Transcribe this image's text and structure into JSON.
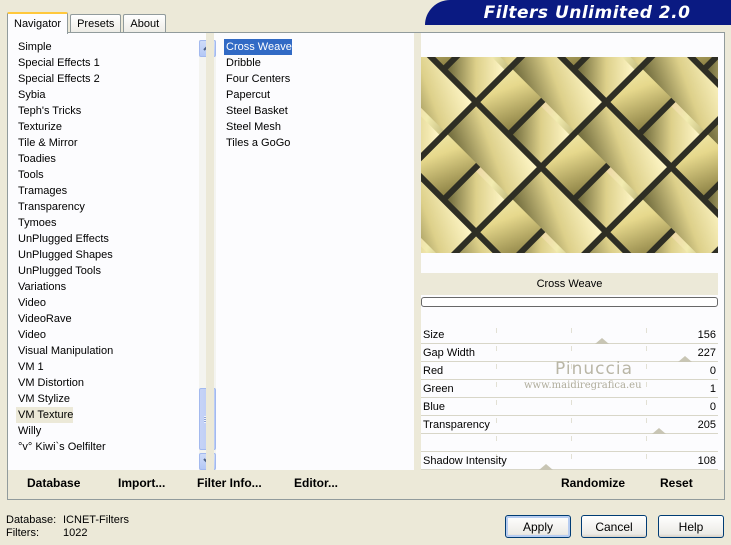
{
  "tabs": [
    {
      "label": "Navigator",
      "active": true
    },
    {
      "label": "Presets",
      "active": false
    },
    {
      "label": "About",
      "active": false
    }
  ],
  "banner": "Filters Unlimited 2.0",
  "categories": [
    "Simple",
    "Special Effects 1",
    "Special Effects 2",
    "Sybia",
    "Teph's Tricks",
    "Texturize",
    "Tile & Mirror",
    "Toadies",
    "Tools",
    "Tramages",
    "Transparency",
    "Tymoes",
    "UnPlugged Effects",
    "UnPlugged Shapes",
    "UnPlugged Tools",
    "Variations",
    "Video",
    "VideoRave",
    "Video",
    "Visual Manipulation",
    "VM 1",
    "VM Distortion",
    "VM Stylize",
    "VM Texture",
    "Willy",
    "°v° Kiwi`s Oelfilter"
  ],
  "selected_category": "VM Texture",
  "filters": [
    "Cross Weave",
    "Dribble",
    "Four Centers",
    "Papercut",
    "Steel Basket",
    "Steel Mesh",
    "Tiles a GoGo"
  ],
  "selected_filter": "Cross Weave",
  "preview_title": "Cross Weave",
  "progress": 0,
  "parameters": [
    {
      "label": "Size",
      "value": "156",
      "level": 0.61
    },
    {
      "label": "Gap Width",
      "value": "227",
      "level": 0.89
    },
    {
      "label": "Red",
      "value": "0",
      "level": 0
    },
    {
      "label": "Green",
      "value": "1",
      "level": 0.004
    },
    {
      "label": "Blue",
      "value": "0",
      "level": 0
    },
    {
      "label": "Transparency",
      "value": "205",
      "level": 0.8
    },
    {
      "label": "",
      "value": "",
      "level": null
    },
    {
      "label": "Shadow Intensity",
      "value": "108",
      "level": 0.42
    }
  ],
  "buttons": {
    "database": "Database",
    "import": "Import...",
    "filter_info": "Filter Info...",
    "editor": "Editor...",
    "randomize": "Randomize",
    "reset": "Reset",
    "apply": "Apply",
    "cancel": "Cancel",
    "help": "Help"
  },
  "footer": {
    "database_label": "Database:",
    "database_value": "ICNET-Filters",
    "filters_label": "Filters:",
    "filters_value": "1022"
  },
  "watermark": {
    "name": "Pinuccia",
    "site": "www.maidiregrafica.eu"
  },
  "colors": {
    "selection": "#316ac5",
    "banner": "#0a1a82",
    "tab_highlight": "#ffc83c",
    "face": "#ece9d8"
  },
  "icons": {
    "scroll_up": "chevron-up-icon",
    "scroll_down": "chevron-down-icon"
  }
}
